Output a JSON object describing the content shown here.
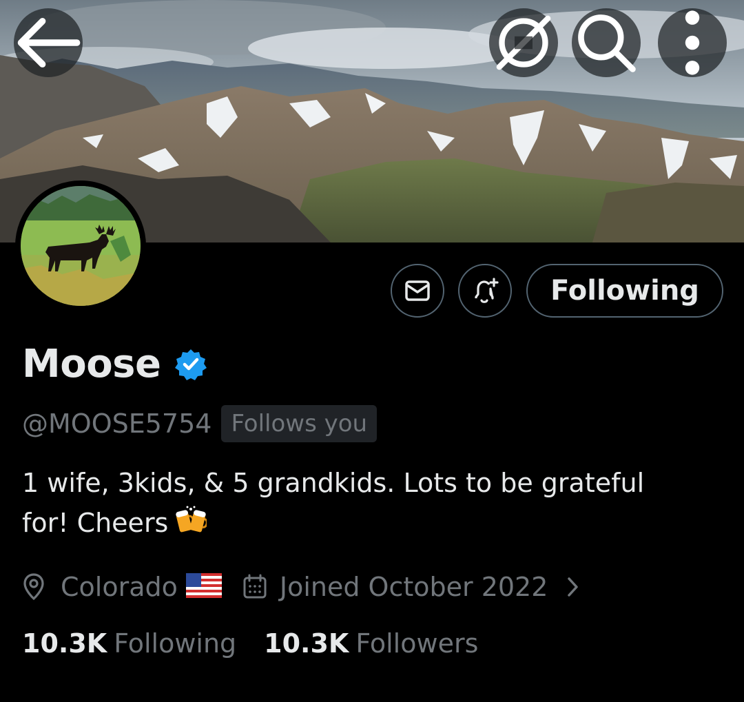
{
  "header": {
    "back_icon": "arrow-left-icon",
    "grok_icon": "grok-icon",
    "search_icon": "search-icon",
    "more_icon": "more-vertical-icon"
  },
  "profile": {
    "display_name": "Moose",
    "verified": true,
    "handle": "@MOOSE5754",
    "follows_you": "Follows you",
    "bio": "1 wife, 3kids, & 5 grandkids. Lots to be grateful\nfor!  Cheers",
    "bio_emoji": "beer-mugs-icon",
    "location": "Colorado",
    "location_flag": "us-flag-icon",
    "joined": "Joined October 2022"
  },
  "actions": {
    "message_icon": "envelope-icon",
    "notify_icon": "bell-plus-icon",
    "following_label": "Following"
  },
  "stats": {
    "following_count": "10.3K",
    "following_label": "Following",
    "followers_count": "10.3K",
    "followers_label": "Followers"
  },
  "colors": {
    "background": "#000000",
    "primary_text": "#e7e9ea",
    "secondary_text": "#71767b",
    "verified_blue": "#1d9bf0",
    "border": "#536471"
  }
}
